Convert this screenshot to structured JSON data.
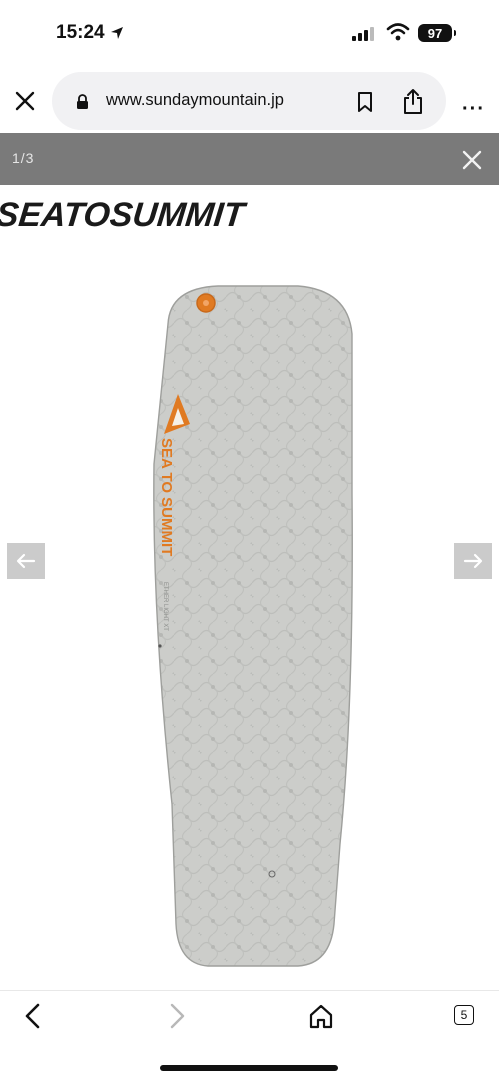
{
  "status": {
    "time": "15:24",
    "battery": "97"
  },
  "browser": {
    "url": "www.sundaymountain.jp"
  },
  "gallery": {
    "counter": "1/3",
    "brand_logo": "SEATOSUMMIT",
    "mat_brand": "SEA TO SUMMIT"
  },
  "toolbar": {
    "tab_count": "5"
  },
  "colors": {
    "gallery_bar": "#7a7a7a",
    "mat_gray": "#c2c4c1",
    "accent_orange": "#e07a22"
  }
}
